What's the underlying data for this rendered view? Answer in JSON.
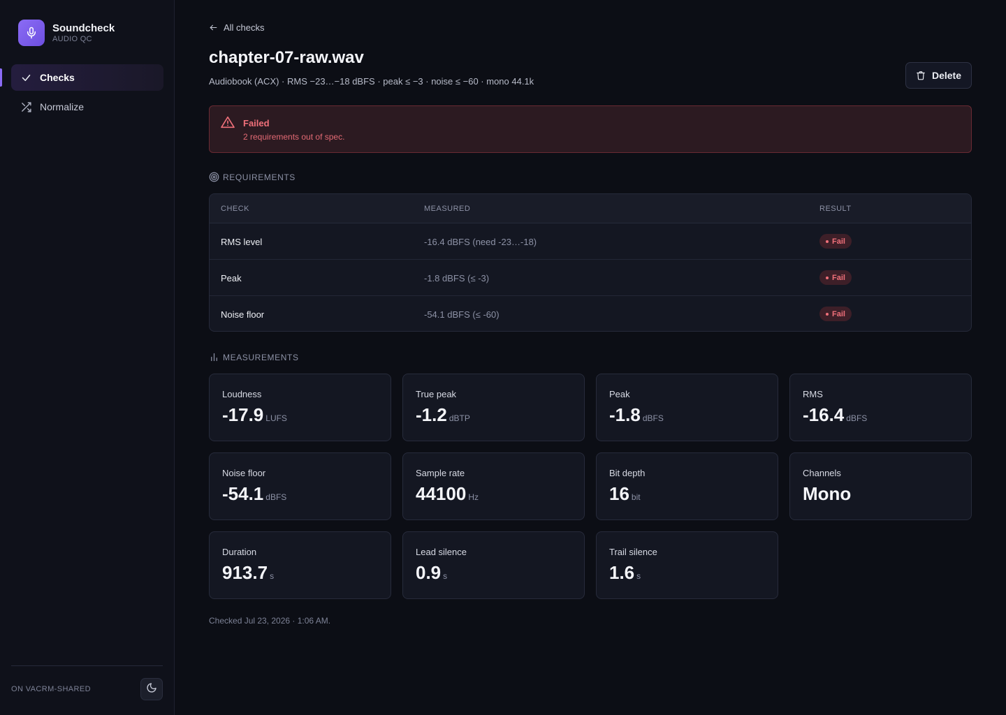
{
  "brand": {
    "name": "Soundcheck",
    "subtitle": "AUDIO QC",
    "logo_icon": "microphone-icon",
    "accent": "#8b6cf5"
  },
  "nav": {
    "items": [
      {
        "label": "Checks",
        "icon": "check-icon",
        "active": true
      },
      {
        "label": "Normalize",
        "icon": "shuffle-icon",
        "active": false
      }
    ]
  },
  "footer": {
    "label": "ON VACRM-SHARED",
    "theme_icon": "moon-icon"
  },
  "header": {
    "back_label": "All checks",
    "title": "chapter-07-raw.wav",
    "subtitle": "Audiobook (ACX) · RMS −23…−18 dBFS · peak ≤ −3 · noise ≤ −60 · mono 44.1k",
    "delete_label": "Delete"
  },
  "alert": {
    "title": "Failed",
    "message": "2 requirements out of spec.",
    "color": "#f0707a"
  },
  "requirements": {
    "section_title": "REQUIREMENTS",
    "columns": [
      "CHECK",
      "MEASURED",
      "RESULT"
    ],
    "rows": [
      {
        "check": "RMS level",
        "measured": "-16.4 dBFS (need -23…-18)",
        "result": "Fail"
      },
      {
        "check": "Peak",
        "measured": "-1.8 dBFS (≤ -3)",
        "result": "Fail"
      },
      {
        "check": "Noise floor",
        "measured": "-54.1 dBFS (≤ -60)",
        "result": "Fail"
      }
    ]
  },
  "measurements": {
    "section_title": "MEASUREMENTS",
    "cards": [
      {
        "label": "Loudness",
        "value": "-17.9",
        "unit": "LUFS"
      },
      {
        "label": "True peak",
        "value": "-1.2",
        "unit": "dBTP"
      },
      {
        "label": "Peak",
        "value": "-1.8",
        "unit": "dBFS"
      },
      {
        "label": "RMS",
        "value": "-16.4",
        "unit": "dBFS"
      },
      {
        "label": "Noise floor",
        "value": "-54.1",
        "unit": "dBFS"
      },
      {
        "label": "Sample rate",
        "value": "44100",
        "unit": "Hz"
      },
      {
        "label": "Bit depth",
        "value": "16",
        "unit": "bit"
      },
      {
        "label": "Channels",
        "value": "Mono",
        "unit": ""
      },
      {
        "label": "Duration",
        "value": "913.7",
        "unit": "s"
      },
      {
        "label": "Lead silence",
        "value": "0.9",
        "unit": "s"
      },
      {
        "label": "Trail silence",
        "value": "1.6",
        "unit": "s"
      }
    ]
  },
  "checked_at": "Checked Jul 23, 2026 · 1:06 AM."
}
